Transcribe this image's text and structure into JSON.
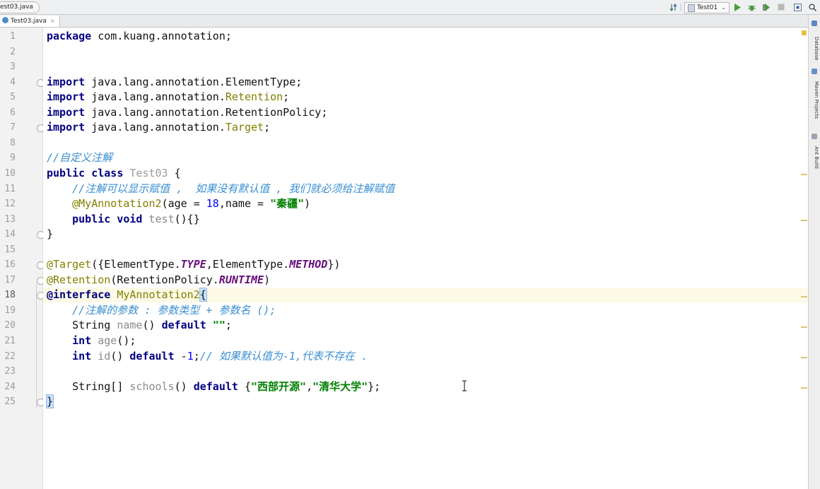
{
  "navbar": {
    "breadcrumb": "est03.java",
    "run_config": "Test01",
    "icons": [
      "sort-icon",
      "run-icon",
      "debug-icon",
      "coverage-icon",
      "stop-icon",
      "build-icon",
      "search-icon"
    ]
  },
  "tab": {
    "label": "Test03.java",
    "close": "×"
  },
  "right_tools": [
    "Database",
    "Maven Projects",
    "Ant Build"
  ],
  "editor": {
    "current_line": 18,
    "lines": [
      {
        "n": "1",
        "tokens": [
          [
            "kw",
            "package"
          ],
          [
            "t",
            " com.kuang.annotation;"
          ]
        ]
      },
      {
        "n": "2",
        "tokens": []
      },
      {
        "n": "3",
        "tokens": []
      },
      {
        "n": "4",
        "fold": true,
        "tokens": [
          [
            "kw",
            "import"
          ],
          [
            "t",
            " java.lang.annotation.ElementType;"
          ]
        ]
      },
      {
        "n": "5",
        "tokens": [
          [
            "kw",
            "import"
          ],
          [
            "t",
            " java.lang.annotation."
          ],
          [
            "ann",
            "Retention"
          ],
          [
            "t",
            ";"
          ]
        ]
      },
      {
        "n": "6",
        "tokens": [
          [
            "kw",
            "import"
          ],
          [
            "t",
            " java.lang.annotation.RetentionPolicy;"
          ]
        ]
      },
      {
        "n": "7",
        "fold": true,
        "tokens": [
          [
            "kw",
            "import"
          ],
          [
            "t",
            " java.lang.annotation."
          ],
          [
            "ann",
            "Target"
          ],
          [
            "t",
            ";"
          ]
        ]
      },
      {
        "n": "8",
        "tokens": []
      },
      {
        "n": "9",
        "tokens": [
          [
            "cmt",
            "//自定义注解"
          ]
        ]
      },
      {
        "n": "10",
        "tokens": [
          [
            "kw",
            "public class"
          ],
          [
            "t",
            " "
          ],
          [
            "cls",
            "Test03"
          ],
          [
            "t",
            " {"
          ]
        ]
      },
      {
        "n": "11",
        "tokens": [
          [
            "t",
            "    "
          ],
          [
            "cmt",
            "//注解可以显示赋值 ,  如果没有默认值 , 我们就必须给注解赋值"
          ]
        ]
      },
      {
        "n": "12",
        "tokens": [
          [
            "t",
            "    "
          ],
          [
            "ann",
            "@MyAnnotation2"
          ],
          [
            "t",
            "(age = "
          ],
          [
            "numv",
            "18"
          ],
          [
            "t",
            ",name = "
          ],
          [
            "str",
            "\"秦疆\""
          ],
          [
            "t",
            ")"
          ]
        ]
      },
      {
        "n": "13",
        "tokens": [
          [
            "t",
            "    "
          ],
          [
            "kw",
            "public void"
          ],
          [
            "t",
            " "
          ],
          [
            "mth",
            "test"
          ],
          [
            "t",
            "(){}"
          ]
        ]
      },
      {
        "n": "14",
        "fold": true,
        "tokens": [
          [
            "t",
            "}"
          ]
        ]
      },
      {
        "n": "15",
        "tokens": []
      },
      {
        "n": "16",
        "fold": true,
        "tokens": [
          [
            "ann",
            "@Target"
          ],
          [
            "t",
            "({ElementType."
          ],
          [
            "cst",
            "TYPE"
          ],
          [
            "t",
            ",ElementType."
          ],
          [
            "cst",
            "METHOD"
          ],
          [
            "t",
            "})"
          ]
        ]
      },
      {
        "n": "17",
        "fold": true,
        "tokens": [
          [
            "ann",
            "@Retention"
          ],
          [
            "t",
            "(RetentionPolicy."
          ],
          [
            "cst",
            "RUNTIME"
          ],
          [
            "t",
            ")"
          ]
        ]
      },
      {
        "n": "18",
        "fold": true,
        "tokens": [
          [
            "kw",
            "@interface"
          ],
          [
            "t",
            " "
          ],
          [
            "ann",
            "MyAnnotation2"
          ],
          [
            "brm",
            "{"
          ]
        ]
      },
      {
        "n": "19",
        "tokens": [
          [
            "t",
            "    "
          ],
          [
            "cmt",
            "//注解的参数 : 参数类型 + 参数名 ();"
          ]
        ]
      },
      {
        "n": "20",
        "tokens": [
          [
            "t",
            "    String "
          ],
          [
            "mth",
            "name"
          ],
          [
            "t",
            "() "
          ],
          [
            "kw",
            "default"
          ],
          [
            "t",
            " "
          ],
          [
            "str",
            "\"\""
          ],
          [
            "t",
            ";"
          ]
        ]
      },
      {
        "n": "21",
        "tokens": [
          [
            "t",
            "    "
          ],
          [
            "kw",
            "int"
          ],
          [
            "t",
            " "
          ],
          [
            "mth",
            "age"
          ],
          [
            "t",
            "();"
          ]
        ]
      },
      {
        "n": "22",
        "tokens": [
          [
            "t",
            "    "
          ],
          [
            "kw",
            "int"
          ],
          [
            "t",
            " "
          ],
          [
            "mth",
            "id"
          ],
          [
            "t",
            "() "
          ],
          [
            "kw",
            "default"
          ],
          [
            "t",
            " -"
          ],
          [
            "numv",
            "1"
          ],
          [
            "t",
            ";"
          ],
          [
            "cmt",
            "// 如果默认值为-1,代表不存在 ."
          ]
        ]
      },
      {
        "n": "23",
        "tokens": []
      },
      {
        "n": "24",
        "tokens": [
          [
            "t",
            "    String[] "
          ],
          [
            "mth",
            "schools"
          ],
          [
            "t",
            "() "
          ],
          [
            "kw",
            "default"
          ],
          [
            "t",
            " {"
          ],
          [
            "str",
            "\"西部开源\""
          ],
          [
            "t",
            ","
          ],
          [
            "str",
            "\"清华大学\""
          ],
          [
            "t",
            "};"
          ]
        ]
      },
      {
        "n": "25",
        "fold": true,
        "tokens": [
          [
            "brm",
            "}"
          ]
        ]
      }
    ]
  },
  "colors": {
    "keyword": "#000080",
    "annotation": "#808000",
    "string": "#008000",
    "number": "#0000ff",
    "comment": "#3a8fd0",
    "constant": "#660e7a",
    "current_line": "#fcfae6",
    "gutter": "#f2f2f2"
  }
}
